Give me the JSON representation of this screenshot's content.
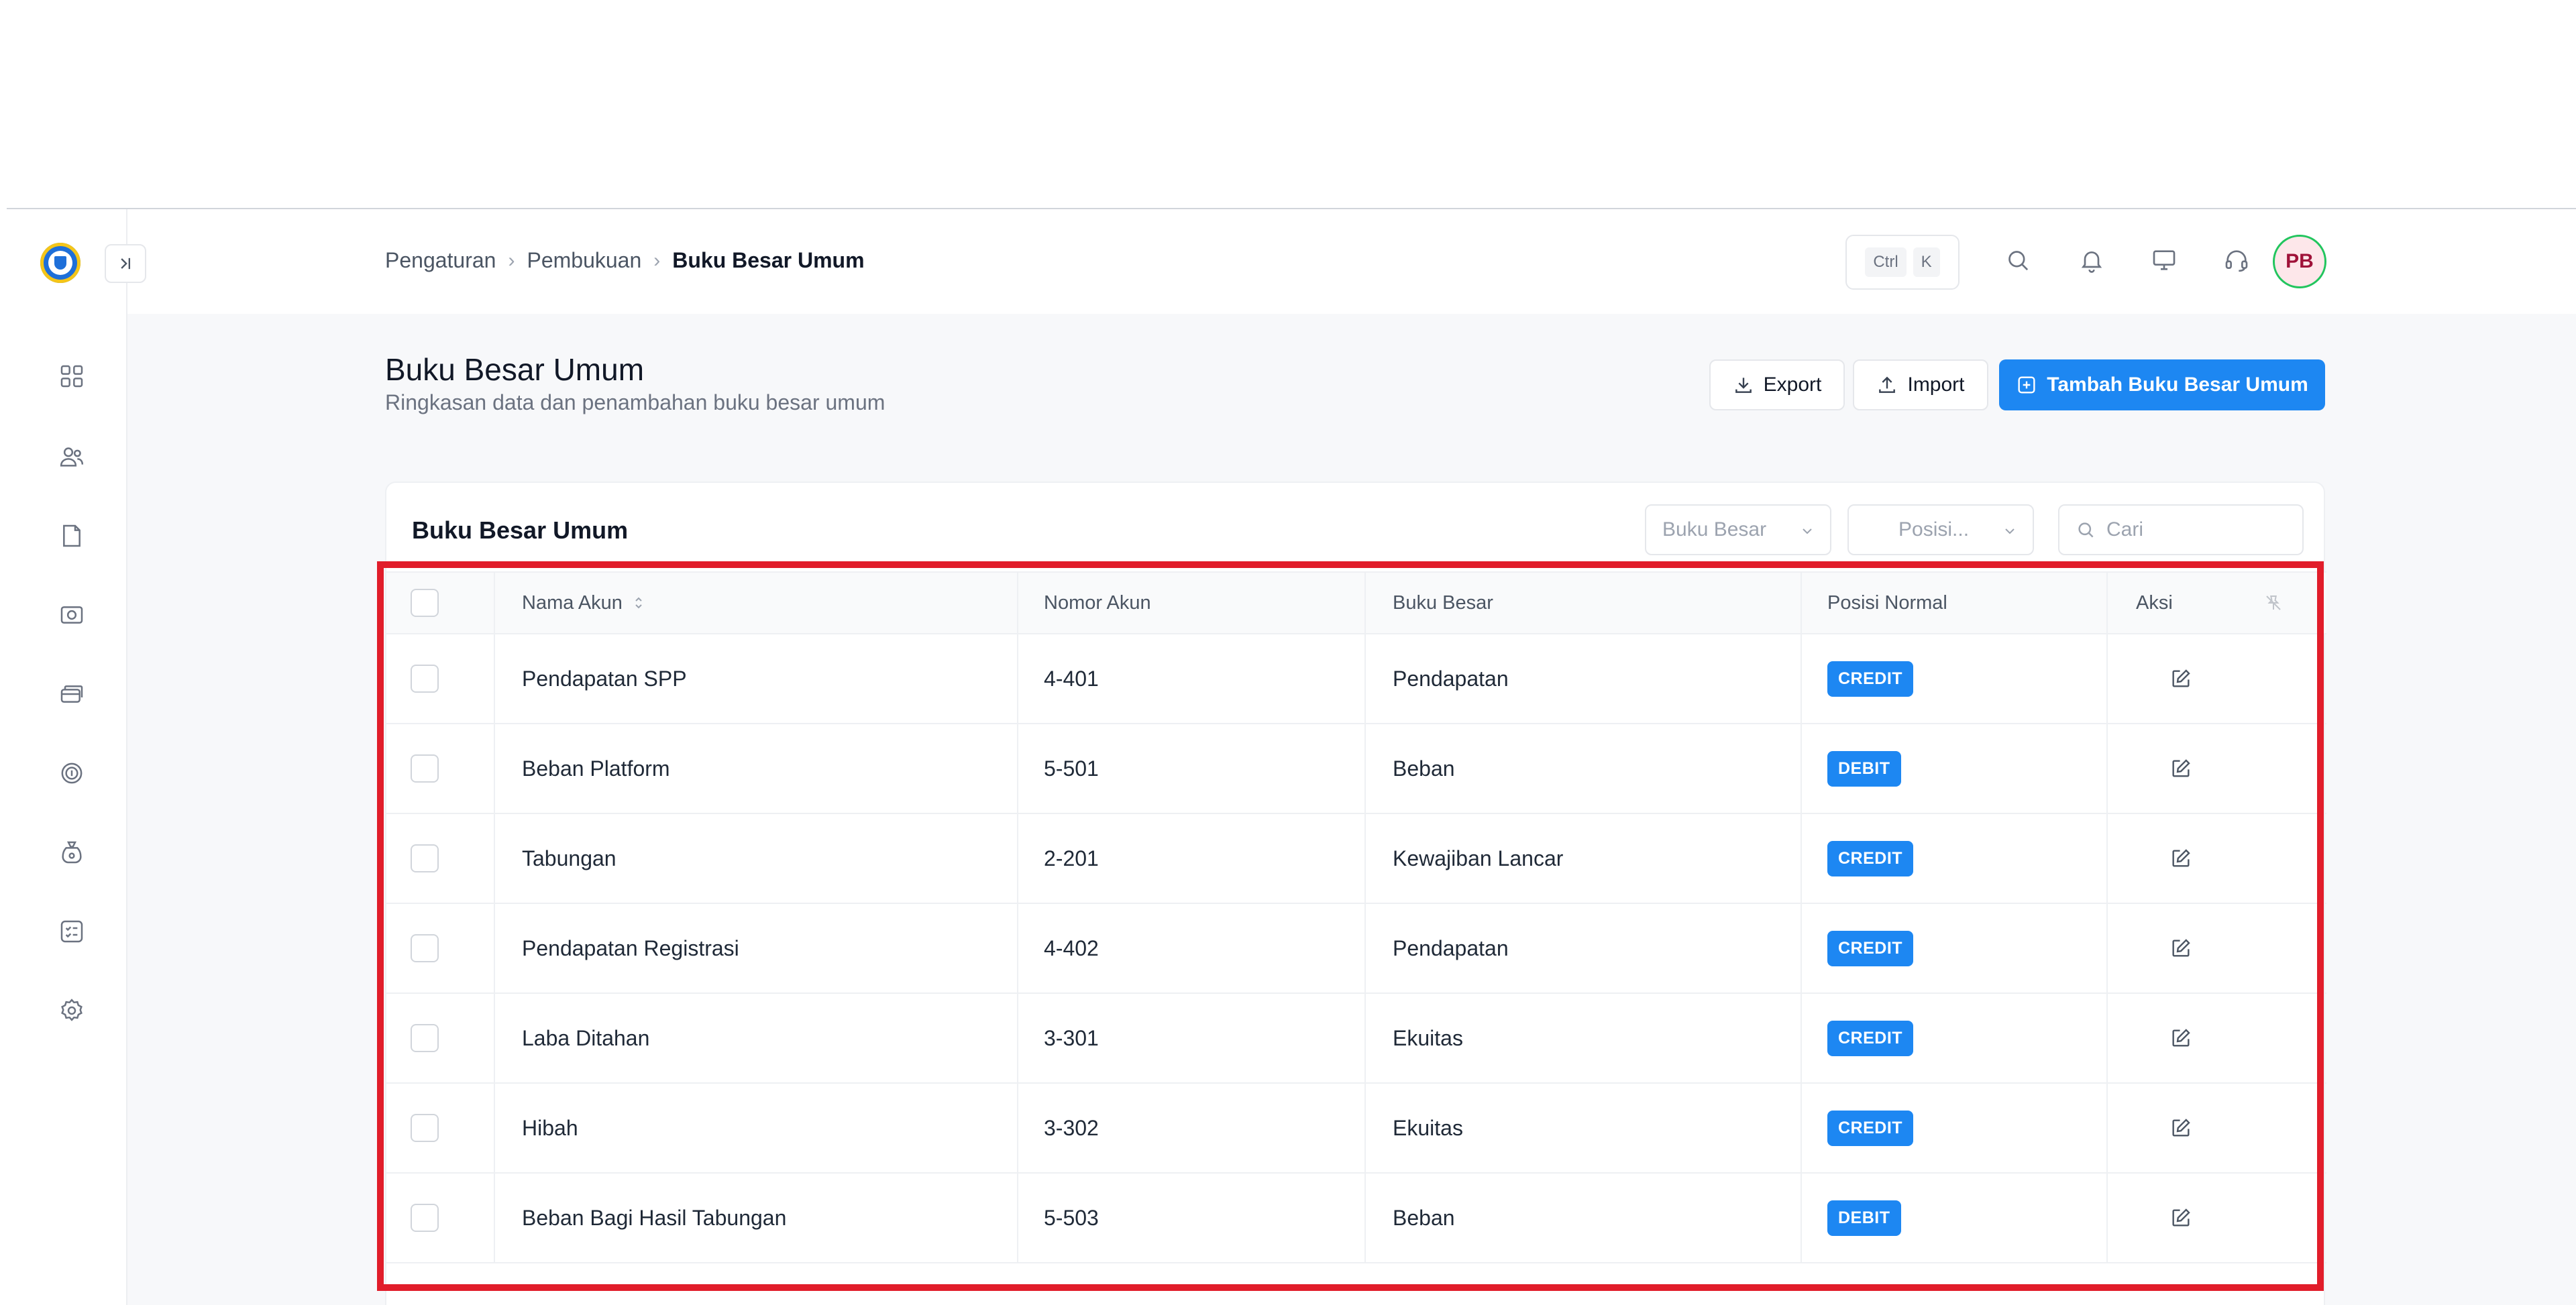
{
  "header": {
    "breadcrumb": [
      "Pengaturan",
      "Pembukuan",
      "Buku Besar Umum"
    ],
    "shortcut_keys": [
      "Ctrl",
      "K"
    ],
    "avatar_initials": "PB",
    "icons": [
      "search-icon",
      "bell-icon",
      "monitor-icon",
      "headset-icon"
    ]
  },
  "sidebar": {
    "icons": [
      "dashboard-icon",
      "users-icon",
      "folder-icon",
      "camera-icon",
      "cards-icon",
      "coin-icon",
      "moneybag-icon",
      "checklist-icon",
      "gear-icon"
    ]
  },
  "page": {
    "title": "Buku Besar Umum",
    "subtitle": "Ringkasan data dan penambahan buku besar umum",
    "export_label": "Export",
    "import_label": "Import",
    "add_label": "Tambah Buku Besar Umum"
  },
  "card": {
    "title": "Buku Besar Umum",
    "filter_ledger_placeholder": "Buku Besar",
    "filter_position_placeholder": "Posisi...",
    "search_placeholder": "Cari"
  },
  "table": {
    "columns": {
      "name": "Nama Akun",
      "number": "Nomor Akun",
      "ledger": "Buku Besar",
      "position": "Posisi Normal",
      "action": "Aksi"
    },
    "rows": [
      {
        "name": "Pendapatan SPP",
        "number": "4-401",
        "ledger": "Pendapatan",
        "position": "CREDIT"
      },
      {
        "name": "Beban Platform",
        "number": "5-501",
        "ledger": "Beban",
        "position": "DEBIT"
      },
      {
        "name": "Tabungan",
        "number": "2-201",
        "ledger": "Kewajiban Lancar",
        "position": "CREDIT"
      },
      {
        "name": "Pendapatan Registrasi",
        "number": "4-402",
        "ledger": "Pendapatan",
        "position": "CREDIT"
      },
      {
        "name": "Laba Ditahan",
        "number": "3-301",
        "ledger": "Ekuitas",
        "position": "CREDIT"
      },
      {
        "name": "Hibah",
        "number": "3-302",
        "ledger": "Ekuitas",
        "position": "CREDIT"
      },
      {
        "name": "Beban Bagi Hasil Tabungan",
        "number": "5-503",
        "ledger": "Beban",
        "position": "DEBIT"
      }
    ]
  },
  "colors": {
    "primary": "#1d87f2",
    "badge_credit": "#1d87f2",
    "badge_debit": "#1d87f2",
    "highlight": "#e11d2a"
  }
}
